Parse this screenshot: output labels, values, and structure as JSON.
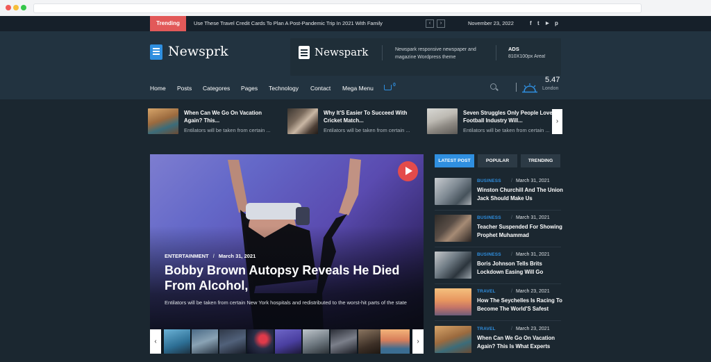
{
  "topbar": {
    "trending_label": "Trending",
    "headline": "Use These Travel Credit Cards To Plan A Post-Pandemic Trip In 2021 With Family",
    "prev_label": "‹",
    "next_label": "›",
    "date": "November 23, 2022",
    "social": [
      "f",
      "t",
      "▶",
      "p"
    ]
  },
  "header": {
    "logo_text": "Newsprk",
    "ad": {
      "logo_text": "Newspark",
      "description": "Newspark responsive newspaper and magazine Wordpress theme",
      "title": "ADS",
      "size": "810X100px Area!"
    }
  },
  "nav": {
    "items": [
      "Home",
      "Posts",
      "Categores",
      "Pages",
      "Technology",
      "Contact",
      "Mega Menu"
    ],
    "cart_count": "0",
    "weather": {
      "temp": "5.47",
      "city": "London"
    }
  },
  "strip": {
    "items": [
      {
        "title": "When Can We Go On Vacation Again? This...",
        "excerpt": "Entilators will be taken from certain ..."
      },
      {
        "title": "Why It'S Easier To Succeed With Cricket Match...",
        "excerpt": "Entilators will be taken from certain ..."
      },
      {
        "title": "Seven Struggles Only People Love Football Industry Will...",
        "excerpt": "Entilators will be taken from certain ..."
      }
    ],
    "next_label": "›"
  },
  "hero": {
    "category": "ENTERTAINMENT",
    "sep": "/",
    "date": "March 31, 2021",
    "title": "Bobby Brown Autopsy Reveals He Died From Alcohol,",
    "excerpt": "Entilators will be taken from certain New York hospitals and redistributed to the worst-hit parts of the state",
    "thumbs_prev": "‹",
    "thumbs_next": "›"
  },
  "sidebar": {
    "tabs": [
      "LATEST POST",
      "POPULAR",
      "TRENDING"
    ],
    "posts": [
      {
        "category": "BUSINESS",
        "date": "March 31, 2021",
        "title": "Winston Churchill And The Union Jack Should Make Us"
      },
      {
        "category": "BUSINESS",
        "date": "March 31, 2021",
        "title": "Teacher Suspended For Showing Prophet Muhammad"
      },
      {
        "category": "BUSINESS",
        "date": "March 31, 2021",
        "title": "Boris Johnson Tells Brits Lockdown Easing Will Go"
      },
      {
        "category": "TRAVEL",
        "date": "March 23, 2021",
        "title": "How The Seychelles Is Racing To Become The World'S Safest"
      },
      {
        "category": "TRAVEL",
        "date": "March 23, 2021",
        "title": "When Can We Go On Vacation Again? This Is What Experts"
      }
    ]
  },
  "colors": {
    "accent": "#2f8fe0",
    "trending": "#e25959",
    "background": "#1b2730"
  }
}
